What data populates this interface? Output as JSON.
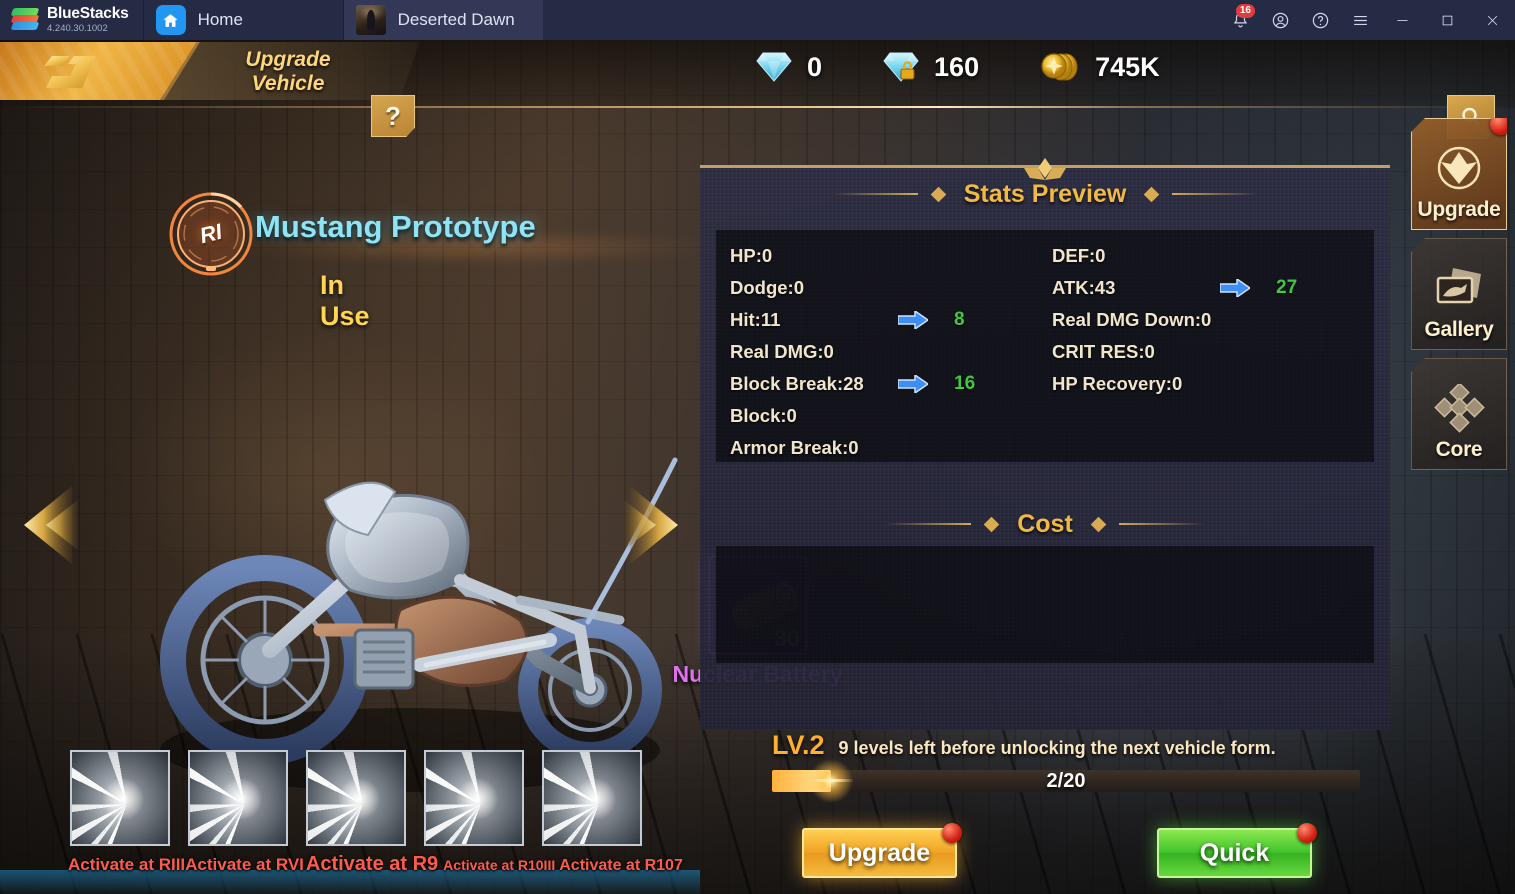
{
  "bluestacks": {
    "brand_name": "BlueStacks",
    "version": "4.240.30.1002",
    "tabs": [
      {
        "label": "Home",
        "icon": "home-icon",
        "active": false
      },
      {
        "label": "Deserted Dawn",
        "icon": "game-thumbnail",
        "active": true
      }
    ],
    "notification_count": "16",
    "system_icons": [
      "bell-icon",
      "account-icon",
      "help-icon",
      "menu-icon"
    ],
    "window_controls": [
      "minimize-icon",
      "maximize-icon",
      "close-icon"
    ]
  },
  "game_header": {
    "title_line1": "Upgrade",
    "title_line2": "Vehicle",
    "help_label": "?",
    "currencies": [
      {
        "icon": "gem-icon",
        "value": "0"
      },
      {
        "icon": "locked-gem-icon",
        "value": "160"
      },
      {
        "icon": "gold-coin-icon",
        "value": "745K"
      }
    ],
    "search_icon": "search-icon"
  },
  "vehicle": {
    "rank_badge": "RI",
    "name": "Mustang Prototype",
    "state": "In Use"
  },
  "side_nav": {
    "items": [
      {
        "label": "Upgrade",
        "icon": "upgrade-chevron-icon",
        "active": true,
        "badge": true
      },
      {
        "label": "Gallery",
        "icon": "gallery-cards-icon",
        "active": false,
        "badge": false
      },
      {
        "label": "Core",
        "icon": "core-diamonds-icon",
        "active": false,
        "badge": false
      }
    ]
  },
  "stats_panel": {
    "title": "Stats Preview",
    "left_column": [
      {
        "label": "HP:0",
        "has_upgrade": false,
        "new_value": ""
      },
      {
        "label": "Dodge:0",
        "has_upgrade": false,
        "new_value": ""
      },
      {
        "label": "Hit:11",
        "has_upgrade": true,
        "new_value": "8"
      },
      {
        "label": "Real DMG:0",
        "has_upgrade": false,
        "new_value": ""
      },
      {
        "label": "Block Break:28",
        "has_upgrade": true,
        "new_value": "16"
      },
      {
        "label": "Block:0",
        "has_upgrade": false,
        "new_value": ""
      },
      {
        "label": "Armor Break:0",
        "has_upgrade": false,
        "new_value": ""
      }
    ],
    "right_column": [
      {
        "label": "DEF:0",
        "has_upgrade": false,
        "new_value": ""
      },
      {
        "label": "ATK:43",
        "has_upgrade": true,
        "new_value": "27"
      },
      {
        "label": "Real DMG Down:0",
        "has_upgrade": false,
        "new_value": ""
      },
      {
        "label": "CRIT RES:0",
        "has_upgrade": false,
        "new_value": ""
      },
      {
        "label": "HP Recovery:0",
        "has_upgrade": false,
        "new_value": ""
      }
    ],
    "accent_color": "#f1b944",
    "upgrade_value_color": "#3ec93e"
  },
  "cost": {
    "title": "Cost",
    "item_name": "Nuclear Battery",
    "item_count": "30",
    "rarity_color": "#d96ff0"
  },
  "level": {
    "level_label": "LV.2",
    "message": "9 levels left before unlocking the next vehicle form.",
    "progress_text": "2/20",
    "progress_percent": 10
  },
  "actions": {
    "upgrade_label": "Upgrade",
    "quick_label": "Quick"
  },
  "skill_thumbs": {
    "labels": [
      "Activate at RIII",
      "Activate at RVI",
      "Activate at R9",
      "Activate at R10III",
      "Activate at R107"
    ],
    "label_color": "#ff5b4a"
  }
}
